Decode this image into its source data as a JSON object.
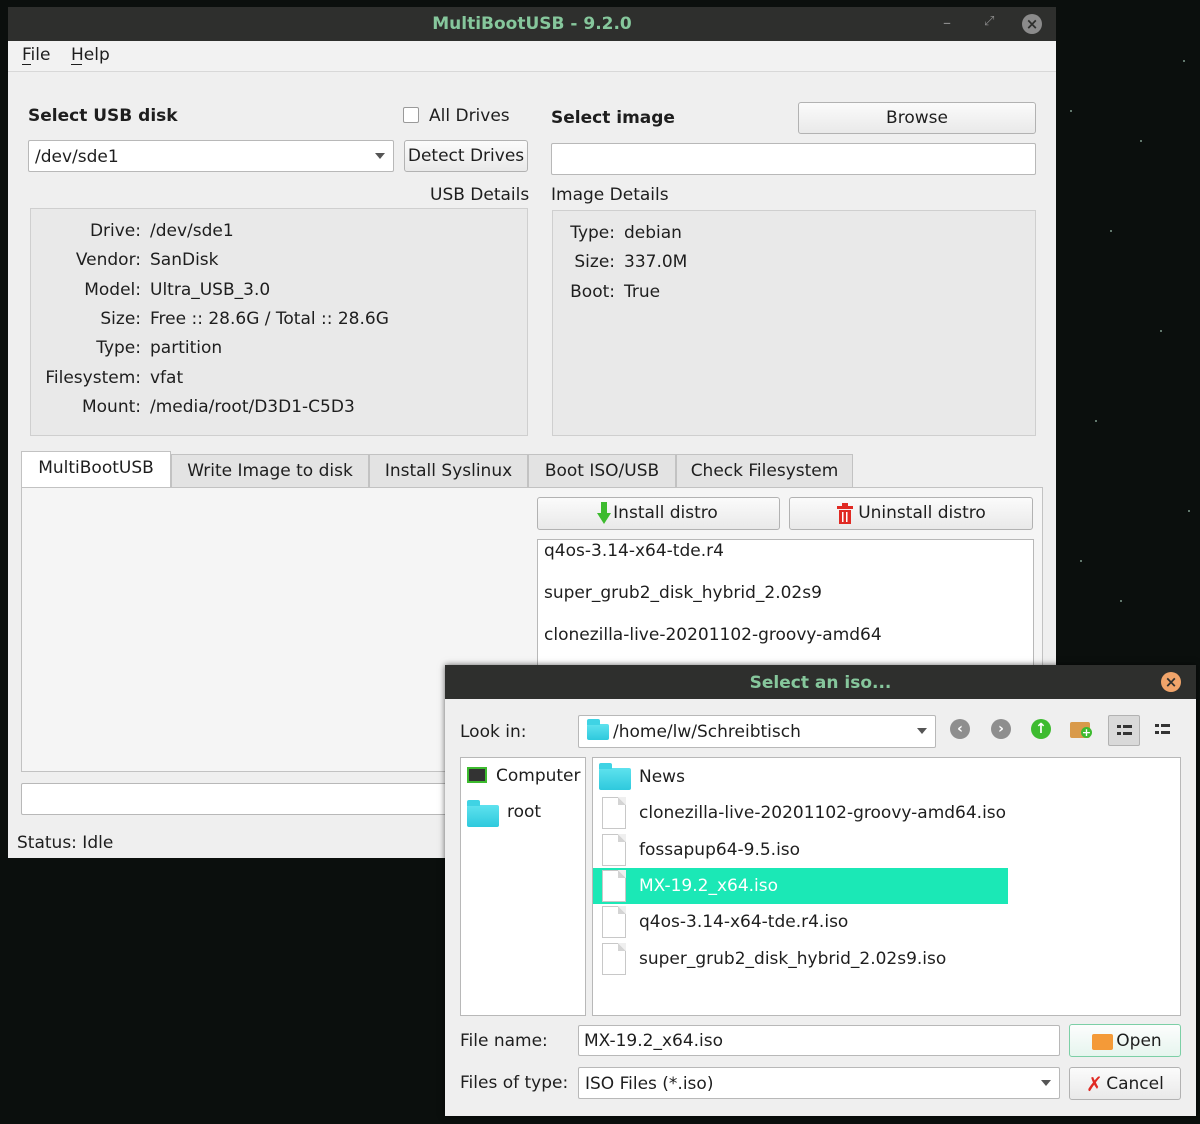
{
  "main_window": {
    "title": "MultiBootUSB - 9.2.0",
    "menu": [
      "File",
      "Help"
    ],
    "usb": {
      "select_label": "Select USB disk",
      "all_drives_label": "All Drives",
      "all_drives_checked": false,
      "selected_disk": "/dev/sde1",
      "detect_button": "Detect Drives",
      "details_title": "USB Details",
      "details": [
        {
          "key": "Drive:",
          "value": "/dev/sde1"
        },
        {
          "key": "Vendor:",
          "value": "SanDisk"
        },
        {
          "key": "Model:",
          "value": "Ultra_USB_3.0"
        },
        {
          "key": "Size:",
          "value": "Free :: 28.6G / Total :: 28.6G"
        },
        {
          "key": "Type:",
          "value": "partition"
        },
        {
          "key": "Filesystem:",
          "value": "vfat"
        },
        {
          "key": "Mount:",
          "value": "/media/root/D3D1-C5D3"
        }
      ]
    },
    "image": {
      "select_label": "Select image",
      "browse_button": "Browse",
      "path_value": "",
      "details_title": "Image Details",
      "details": [
        {
          "key": "Type:",
          "value": "debian"
        },
        {
          "key": "Size:",
          "value": "337.0M"
        },
        {
          "key": "Boot:",
          "value": "True"
        }
      ]
    },
    "tabs": [
      "MultiBootUSB",
      "Write Image to disk",
      "Install Syslinux",
      "Boot ISO/USB",
      "Check Filesystem"
    ],
    "active_tab": "MultiBootUSB",
    "install_button": "Install distro",
    "uninstall_button": "Uninstall distro",
    "installed_distros": [
      "q4os-3.14-x64-tde.r4",
      "super_grub2_disk_hybrid_2.02s9",
      "clonezilla-live-20201102-groovy-amd64"
    ],
    "progress_percent": 0,
    "status": "Status: Idle"
  },
  "dialog": {
    "title": "Select an iso...",
    "look_in_label": "Look in:",
    "look_in_path": "/home/lw/Schreibtisch",
    "toolbar_icons": [
      "back-icon",
      "forward-icon",
      "parent-directory-icon",
      "new-folder-icon",
      "list-view-icon",
      "detail-view-icon"
    ],
    "sidebar": [
      {
        "label": "Computer",
        "icon": "computer-icon"
      },
      {
        "label": "root",
        "icon": "folder-icon"
      }
    ],
    "files": [
      {
        "name": "News",
        "type": "folder"
      },
      {
        "name": "clonezilla-live-20201102-groovy-amd64.iso",
        "type": "file"
      },
      {
        "name": "fossapup64-9.5.iso",
        "type": "file"
      },
      {
        "name": "MX-19.2_x64.iso",
        "type": "file",
        "selected": true
      },
      {
        "name": "q4os-3.14-x64-tde.r4.iso",
        "type": "file"
      },
      {
        "name": "super_grub2_disk_hybrid_2.02s9.iso",
        "type": "file"
      }
    ],
    "file_name_label": "File name:",
    "file_name_value": "MX-19.2_x64.iso",
    "files_of_type_label": "Files of type:",
    "files_of_type_value": "ISO Files (*.iso)",
    "open_button": "Open",
    "cancel_button": "Cancel"
  },
  "colors": {
    "title_text": "#86c79c",
    "selection": "#1be8b6",
    "folder": "#3fd3e4"
  }
}
